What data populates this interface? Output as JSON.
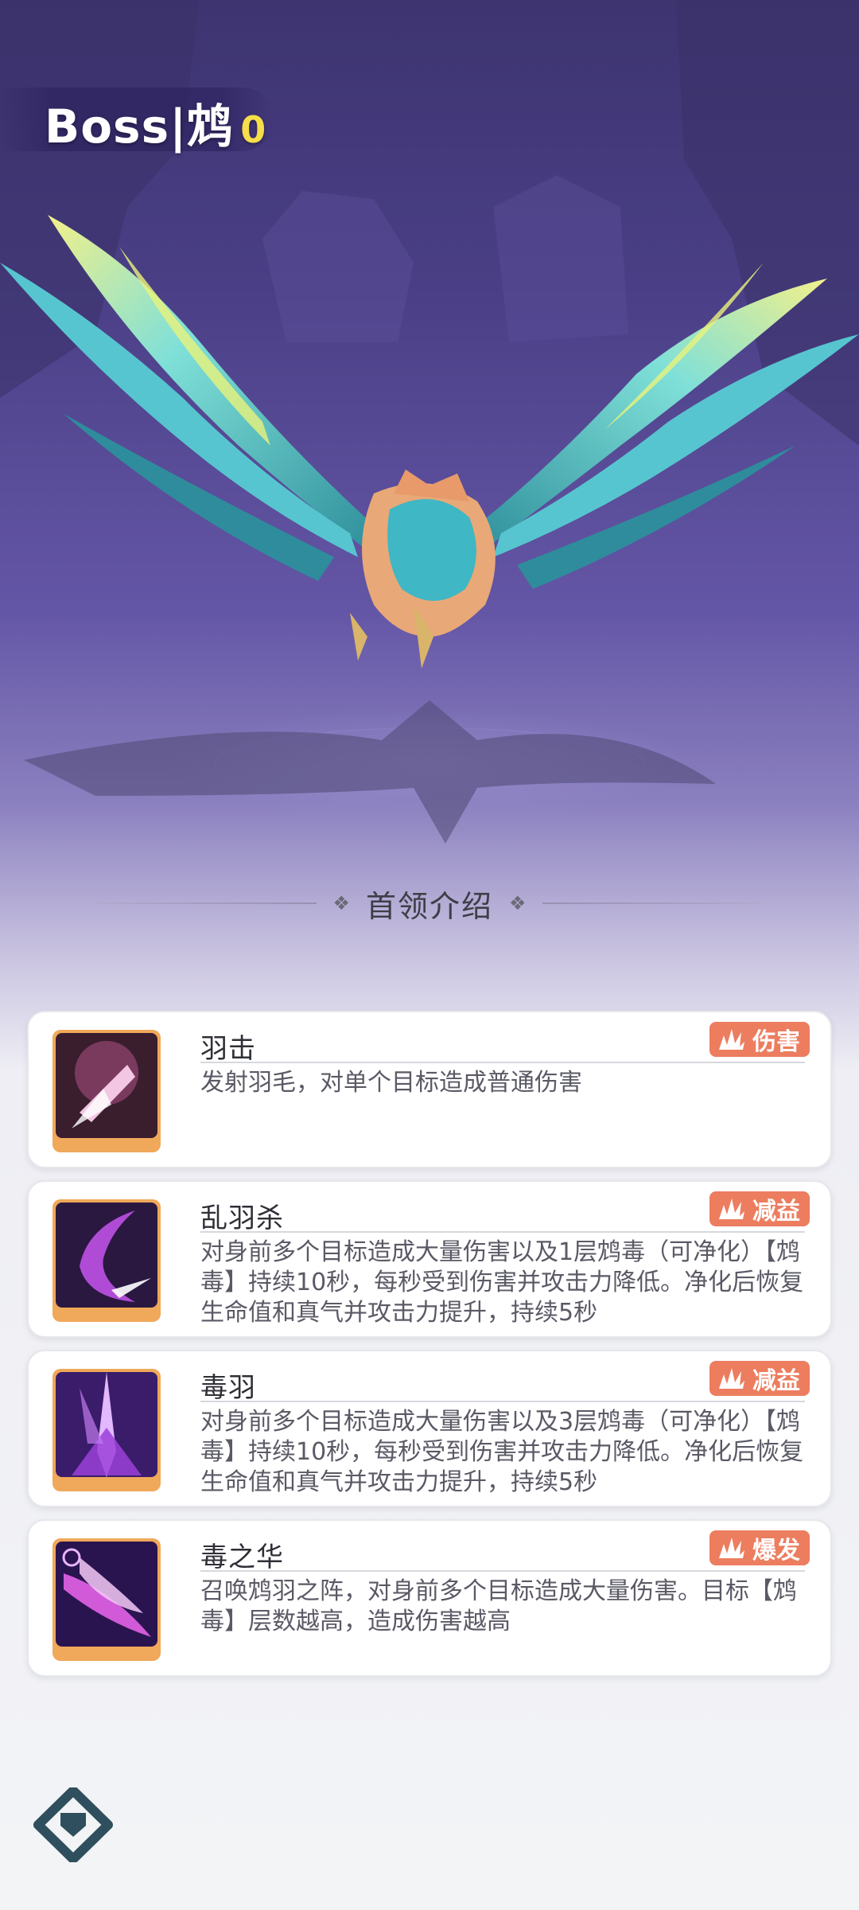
{
  "header": {
    "title": "Boss|鸩",
    "star_count": "0"
  },
  "section": {
    "title": "首领介绍"
  },
  "skills": [
    {
      "name": "羽击",
      "tag": "伤害",
      "desc": "发射羽毛，对单个目标造成普通伤害"
    },
    {
      "name": "乱羽杀",
      "tag": "减益",
      "desc": "对身前多个目标造成大量伤害以及1层鸩毒（可净化）【鸩毒】持续10秒，每秒受到伤害并攻击力降低。净化后恢复生命值和真气并攻击力提升，持续5秒"
    },
    {
      "name": "毒羽",
      "tag": "减益",
      "desc": "对身前多个目标造成大量伤害以及3层鸩毒（可净化）【鸩毒】持续10秒，每秒受到伤害并攻击力降低。净化后恢复生命值和真气并攻击力提升，持续5秒"
    },
    {
      "name": "毒之华",
      "tag": "爆发",
      "desc": "召唤鸩羽之阵，对身前多个目标造成大量伤害。目标【鸩毒】层数越高，造成伤害越高"
    }
  ],
  "colors": {
    "tag": "#ec7d5f",
    "icon_frame": "#f0a85a",
    "stars": "#f6dd4a"
  },
  "icons": {
    "tag": "claw-icon",
    "logo": "game-logo-icon"
  }
}
